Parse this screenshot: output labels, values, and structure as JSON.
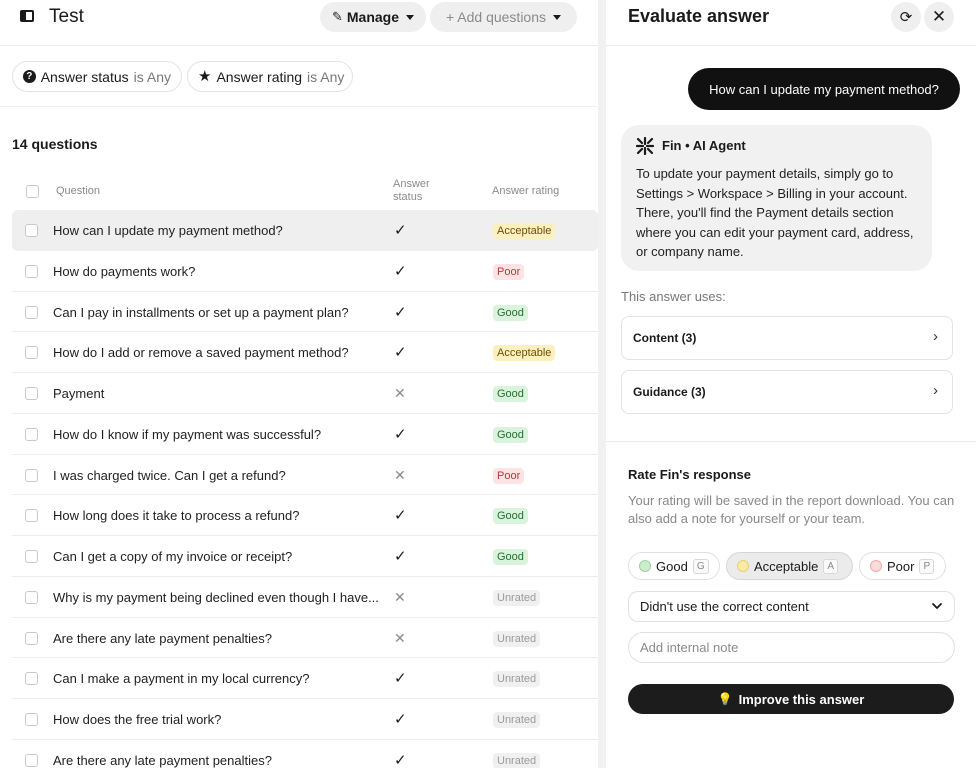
{
  "header": {
    "title": "Test",
    "manage_label": "Manage",
    "add_questions_label": "+ Add questions"
  },
  "filters": {
    "status_name": "Answer status",
    "status_value": "is Any",
    "rating_name": "Answer rating",
    "rating_value": "is Any"
  },
  "table": {
    "count_label": "14 questions",
    "col_question": "Question",
    "col_status": "Answer status",
    "col_rating": "Answer rating",
    "rows": [
      {
        "question": "How can I update my payment method?",
        "status": "✓",
        "rating": "Acceptable",
        "rating_class": "acceptable"
      },
      {
        "question": "How do payments work?",
        "status": "✓",
        "rating": "Poor",
        "rating_class": "poor"
      },
      {
        "question": "Can I pay in installments or set up a payment plan?",
        "status": "✓",
        "rating": "Good",
        "rating_class": "good"
      },
      {
        "question": "How do I add or remove a saved payment method?",
        "status": "✓",
        "rating": "Acceptable",
        "rating_class": "acceptable"
      },
      {
        "question": "Payment",
        "status": "✕",
        "rating": "Good",
        "rating_class": "good"
      },
      {
        "question": "How do I know if my payment was successful?",
        "status": "✓",
        "rating": "Good",
        "rating_class": "good"
      },
      {
        "question": "I was charged twice. Can I get a refund?",
        "status": "✕",
        "rating": "Poor",
        "rating_class": "poor"
      },
      {
        "question": "How long does it take to process a refund?",
        "status": "✓",
        "rating": "Good",
        "rating_class": "good"
      },
      {
        "question": "Can I get a copy of my invoice or receipt?",
        "status": "✓",
        "rating": "Good",
        "rating_class": "good"
      },
      {
        "question": "Why is my payment being declined even though I have...",
        "status": "✕",
        "rating": "Unrated",
        "rating_class": "unrated"
      },
      {
        "question": "Are there any late payment penalties?",
        "status": "✕",
        "rating": "Unrated",
        "rating_class": "unrated"
      },
      {
        "question": "Can I make a payment in my local currency?",
        "status": "✓",
        "rating": "Unrated",
        "rating_class": "unrated"
      },
      {
        "question": "How does the free trial work?",
        "status": "✓",
        "rating": "Unrated",
        "rating_class": "unrated"
      },
      {
        "question": "Are there any late payment penalties?",
        "status": "✓",
        "rating": "Unrated",
        "rating_class": "unrated"
      }
    ]
  },
  "panel": {
    "title": "Evaluate answer",
    "user_message": "How can I update my payment method?",
    "agent_name": "Fin • AI Agent",
    "agent_answer": "To update your payment details, simply go to Settings > Workspace > Billing in your account. There, you'll find the Payment details section where you can edit your payment card, address, or company name.",
    "uses_label": "This answer uses:",
    "content_label": "Content (3)",
    "guidance_label": "Guidance (3)",
    "rate_title": "Rate Fin's response",
    "rate_desc": "Your rating will be saved in the report download. You can also add a note for yourself or your team.",
    "options": [
      {
        "label": "Good",
        "key": "G"
      },
      {
        "label": "Acceptable",
        "key": "A"
      },
      {
        "label": "Poor",
        "key": "P"
      }
    ],
    "selected_option": "Acceptable",
    "reason_value": "Didn't use the correct content",
    "note_placeholder": "Add internal note",
    "improve_label": "Improve this answer"
  },
  "colors": {
    "accent_dark": "#111111",
    "good": "#22702f",
    "acceptable": "#6b5000",
    "poor": "#b23a3a"
  },
  "icons": [
    "sidebar-toggle-icon",
    "pencil-icon",
    "question-circle-icon",
    "star-icon",
    "refresh-icon",
    "close-icon",
    "fin-logo-icon",
    "chevron-right-icon",
    "chevron-down-icon",
    "lightbulb-icon"
  ]
}
